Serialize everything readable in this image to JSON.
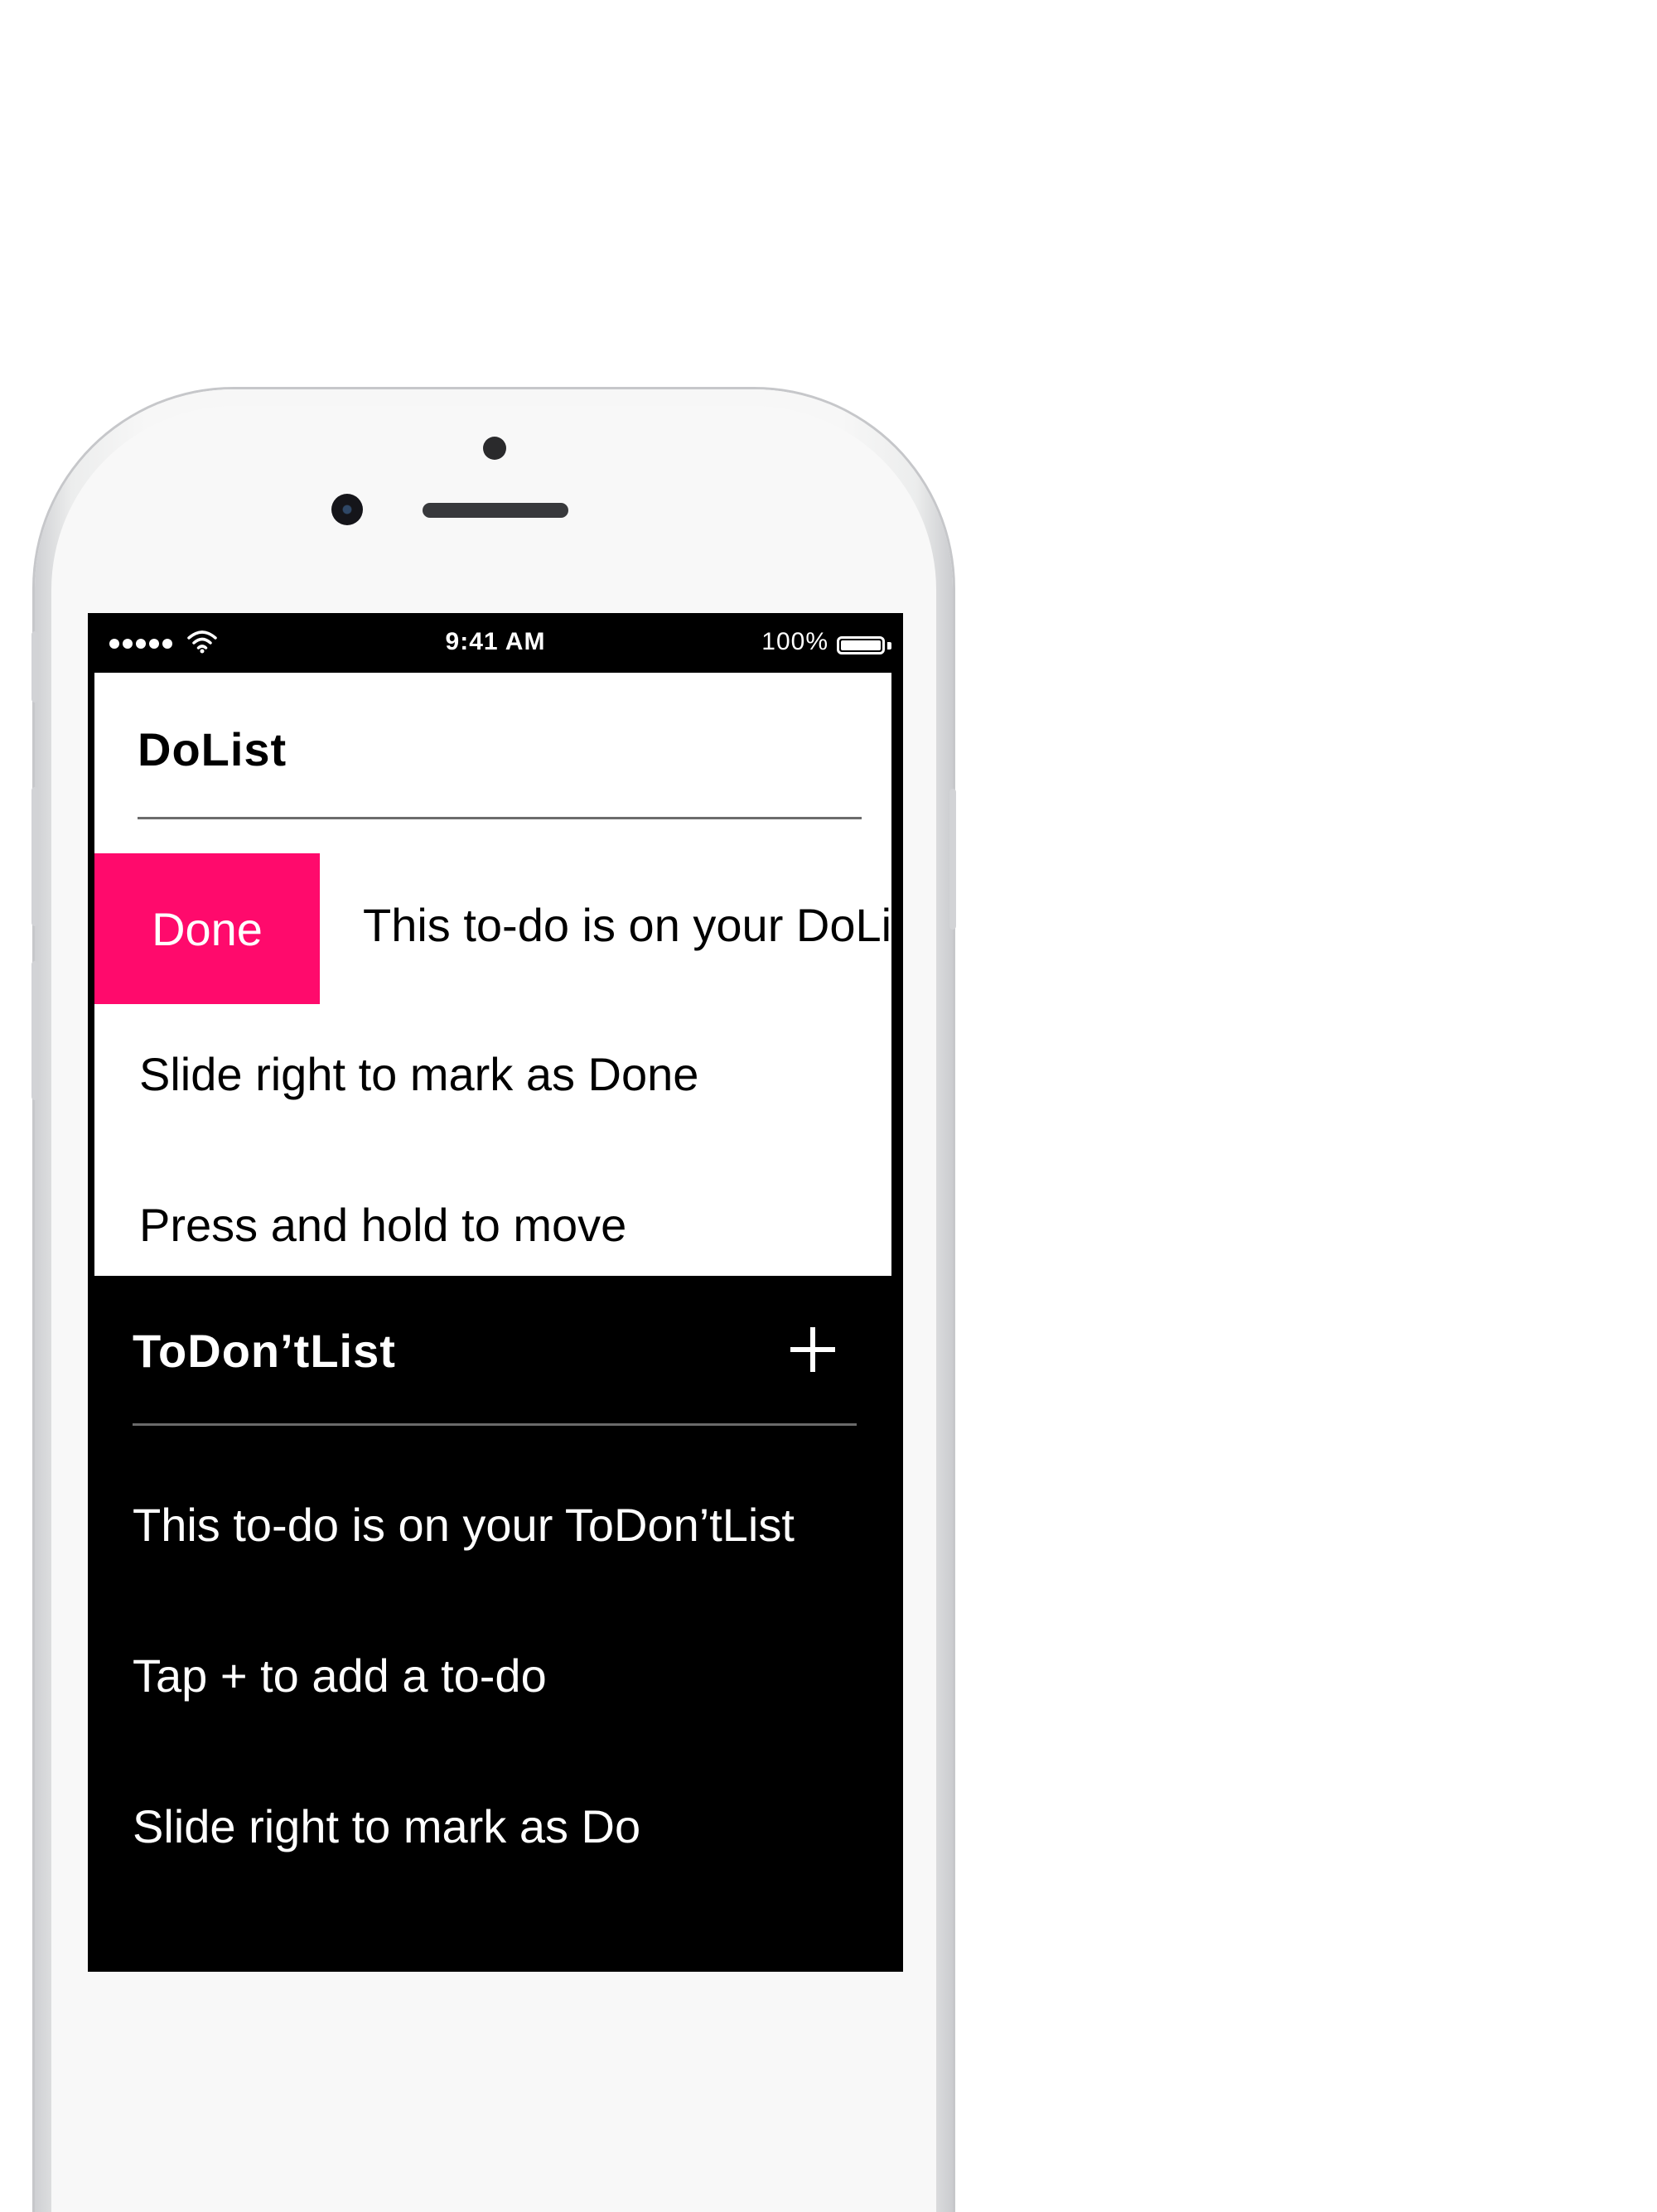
{
  "status_bar": {
    "time": "9:41 AM",
    "battery": "100%",
    "signal_icon": "cellular-signal-icon",
    "wifi_icon": "wifi-icon",
    "battery_icon": "battery-icon"
  },
  "do_list": {
    "title": "DoList",
    "swipe_action": "Done",
    "swipe_color": "#ff0a6c",
    "items": [
      "This to-do is on your DoList",
      "Slide right to mark as Done",
      "Press and hold to move"
    ]
  },
  "dont_list": {
    "title": "ToDon’tList",
    "add_icon": "plus-icon",
    "items": [
      "This to-do is on your ToDon’tList",
      "Tap + to add a to-do",
      "Slide right to mark as Do"
    ]
  }
}
